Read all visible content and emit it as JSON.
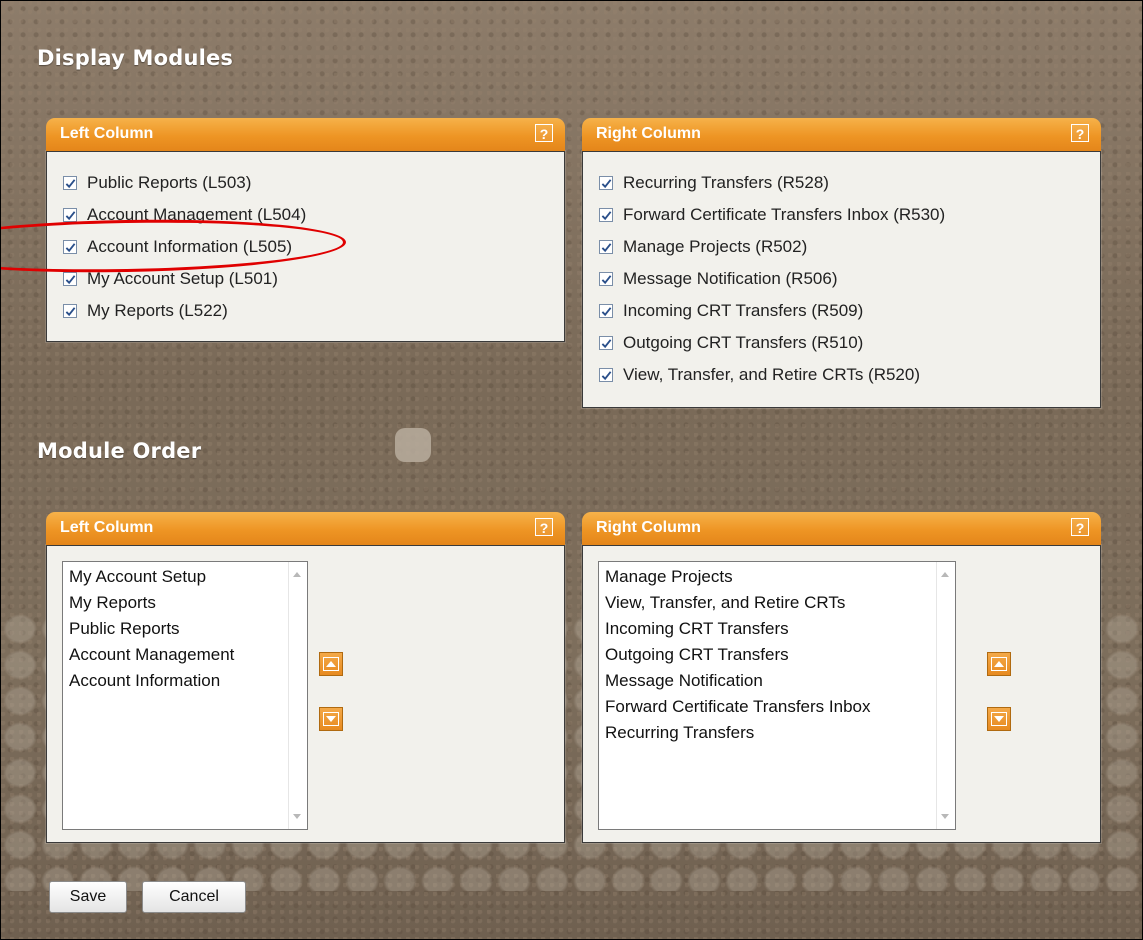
{
  "display_modules": {
    "title": "Display Modules",
    "left": {
      "header": "Left Column",
      "help": "?",
      "items": [
        {
          "label": "Public Reports (L503)",
          "checked": true
        },
        {
          "label": "Account Management (L504)",
          "checked": true
        },
        {
          "label": "Account Information (L505)",
          "checked": true
        },
        {
          "label": "My Account Setup (L501)",
          "checked": true
        },
        {
          "label": "My Reports (L522)",
          "checked": true
        }
      ]
    },
    "right": {
      "header": "Right Column",
      "help": "?",
      "items": [
        {
          "label": "Recurring Transfers (R528)",
          "checked": true
        },
        {
          "label": "Forward Certificate Transfers Inbox (R530)",
          "checked": true
        },
        {
          "label": "Manage Projects (R502)",
          "checked": true
        },
        {
          "label": "Message Notification (R506)",
          "checked": true
        },
        {
          "label": "Incoming CRT Transfers (R509)",
          "checked": true
        },
        {
          "label": "Outgoing CRT Transfers (R510)",
          "checked": true
        },
        {
          "label": "View, Transfer, and Retire CRTs (R520)",
          "checked": true
        }
      ]
    }
  },
  "module_order": {
    "title": "Module Order",
    "left": {
      "header": "Left Column",
      "help": "?",
      "items": [
        "My Account Setup",
        "My Reports",
        "Public Reports",
        "Account Management",
        "Account Information"
      ]
    },
    "right": {
      "header": "Right Column",
      "help": "?",
      "items": [
        "Manage Projects",
        "View, Transfer, and Retire CRTs",
        "Incoming CRT Transfers",
        "Outgoing CRT Transfers",
        "Message Notification",
        "Forward Certificate Transfers Inbox",
        "Recurring Transfers"
      ]
    }
  },
  "buttons": {
    "save": "Save",
    "cancel": "Cancel"
  },
  "colors": {
    "header_orange": "#ee9524",
    "annotation_red": "#e00000"
  }
}
